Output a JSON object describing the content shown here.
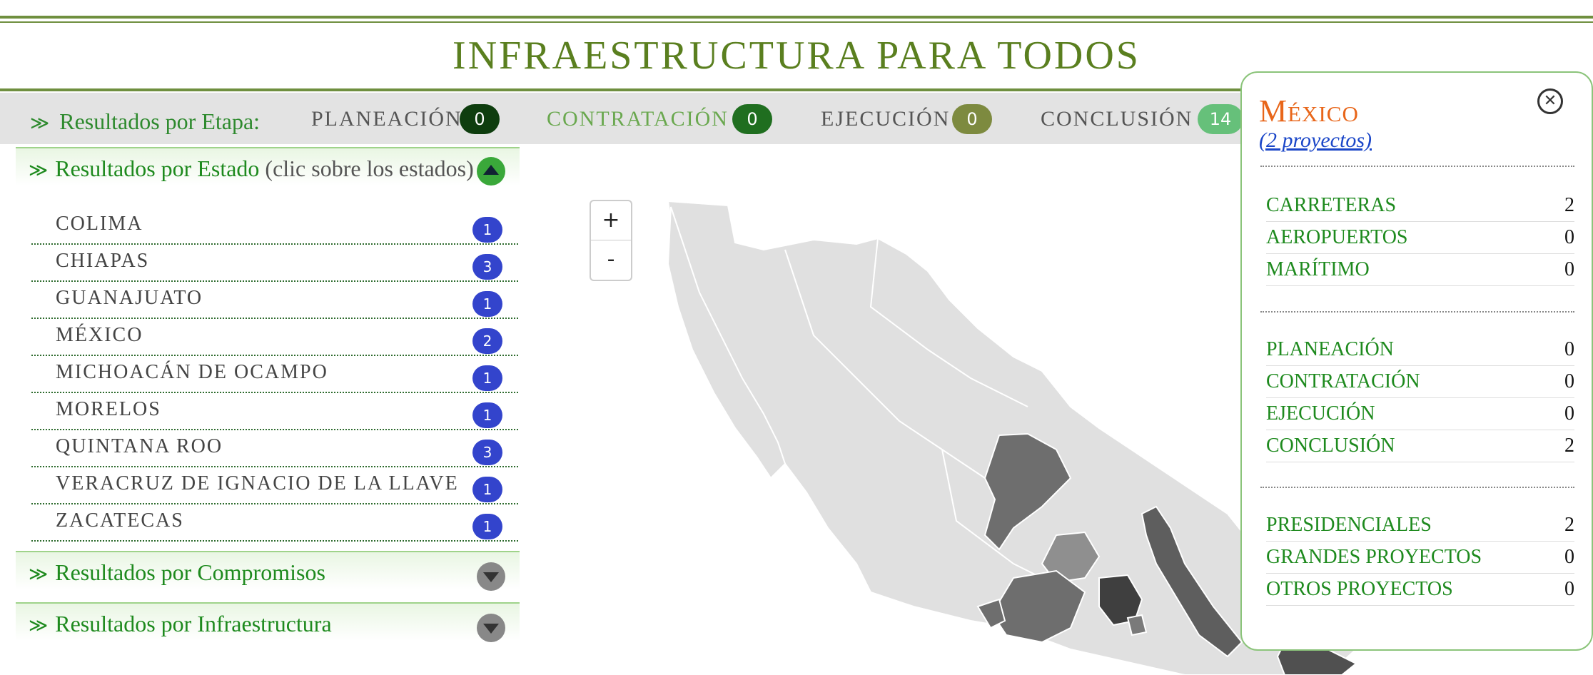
{
  "header": {
    "title": "INFRAESTRUCTURA PARA TODOS"
  },
  "stages": {
    "label": "Resultados por Etapa:",
    "items": [
      {
        "name": "PLANEACIÓN",
        "count": "0",
        "color": "#0e3d0e",
        "text_color": "#555555"
      },
      {
        "name": "CONTRATACIÓN",
        "count": "0",
        "color": "#1f6e1f",
        "text_color": "#6aa84f"
      },
      {
        "name": "EJECUCIÓN",
        "count": "0",
        "color": "#7d8a3f",
        "text_color": "#555555"
      },
      {
        "name": "CONCLUSIÓN",
        "count": "14",
        "color": "#66c07a",
        "text_color": "#555555"
      }
    ]
  },
  "sections": {
    "estado": {
      "label": "Resultados por Estado",
      "hint": "(clic sobre los estados)"
    },
    "compromisos": {
      "label": "Resultados por Compromisos"
    },
    "infraestructura": {
      "label": "Resultados por Infraestructura"
    }
  },
  "states": [
    {
      "name": "COLIMA",
      "count": "1"
    },
    {
      "name": "CHIAPAS",
      "count": "3"
    },
    {
      "name": "GUANAJUATO",
      "count": "1"
    },
    {
      "name": "MÉXICO",
      "count": "2"
    },
    {
      "name": "MICHOACÁN DE OCAMPO",
      "count": "1"
    },
    {
      "name": "MORELOS",
      "count": "1"
    },
    {
      "name": "QUINTANA ROO",
      "count": "3"
    },
    {
      "name": "VERACRUZ DE IGNACIO DE LA LLAVE",
      "count": "1"
    },
    {
      "name": "ZACATECAS",
      "count": "1"
    }
  ],
  "map": {
    "zoom_in": "+",
    "zoom_out": "-"
  },
  "panel": {
    "title": "México",
    "link": "(2 proyectos)",
    "close_icon": "close-circle-icon",
    "groups": [
      [
        {
          "label": "CARRETERAS",
          "value": "2"
        },
        {
          "label": "AEROPUERTOS",
          "value": "0"
        },
        {
          "label": "MARÍTIMO",
          "value": "0"
        }
      ],
      [
        {
          "label": "PLANEACIÓN",
          "value": "0"
        },
        {
          "label": "CONTRATACIÓN",
          "value": "0"
        },
        {
          "label": "EJECUCIÓN",
          "value": "0"
        },
        {
          "label": "CONCLUSIÓN",
          "value": "2"
        }
      ],
      [
        {
          "label": "PRESIDENCIALES",
          "value": "2"
        },
        {
          "label": "GRANDES PROYECTOS",
          "value": "0"
        },
        {
          "label": "OTROS PROYECTOS",
          "value": "0"
        }
      ]
    ]
  },
  "colors": {
    "accent_green": "#1e8a1e",
    "title_green": "#5a7f1f",
    "badge_blue": "#3344cc",
    "panel_title": "#e8661a"
  }
}
